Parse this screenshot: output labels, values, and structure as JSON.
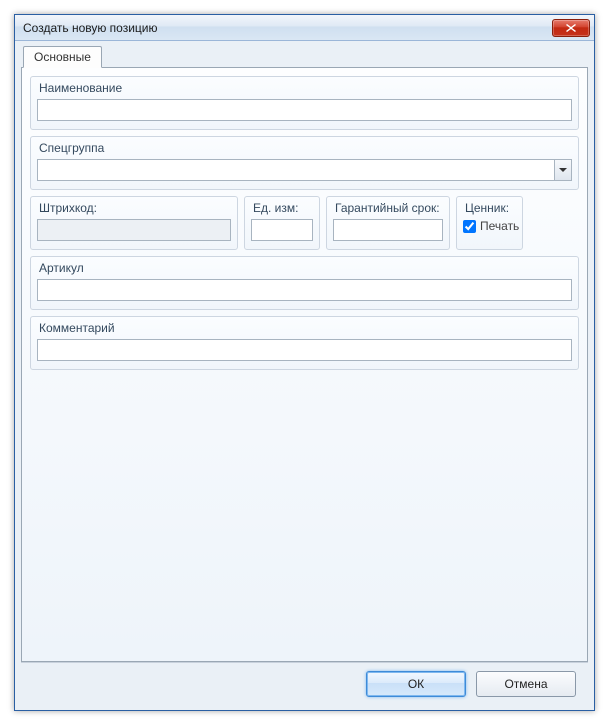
{
  "window": {
    "title": "Создать новую позицию"
  },
  "tabs": {
    "main": "Основные"
  },
  "fields": {
    "name": {
      "label": "Наименование",
      "value": ""
    },
    "specgroup": {
      "label": "Спецгруппа",
      "value": ""
    },
    "barcode": {
      "label": "Штрихкод:",
      "value": ""
    },
    "unit": {
      "label": "Ед. изм:",
      "value": ""
    },
    "warranty": {
      "label": "Гарантийный срок:",
      "value": ""
    },
    "pricetag": {
      "label": "Ценник:",
      "checkbox_label": "Печать",
      "checked": true
    },
    "article": {
      "label": "Артикул",
      "value": ""
    },
    "comment": {
      "label": "Комментарий",
      "value": ""
    }
  },
  "buttons": {
    "ok": "ОК",
    "cancel": "Отмена"
  }
}
